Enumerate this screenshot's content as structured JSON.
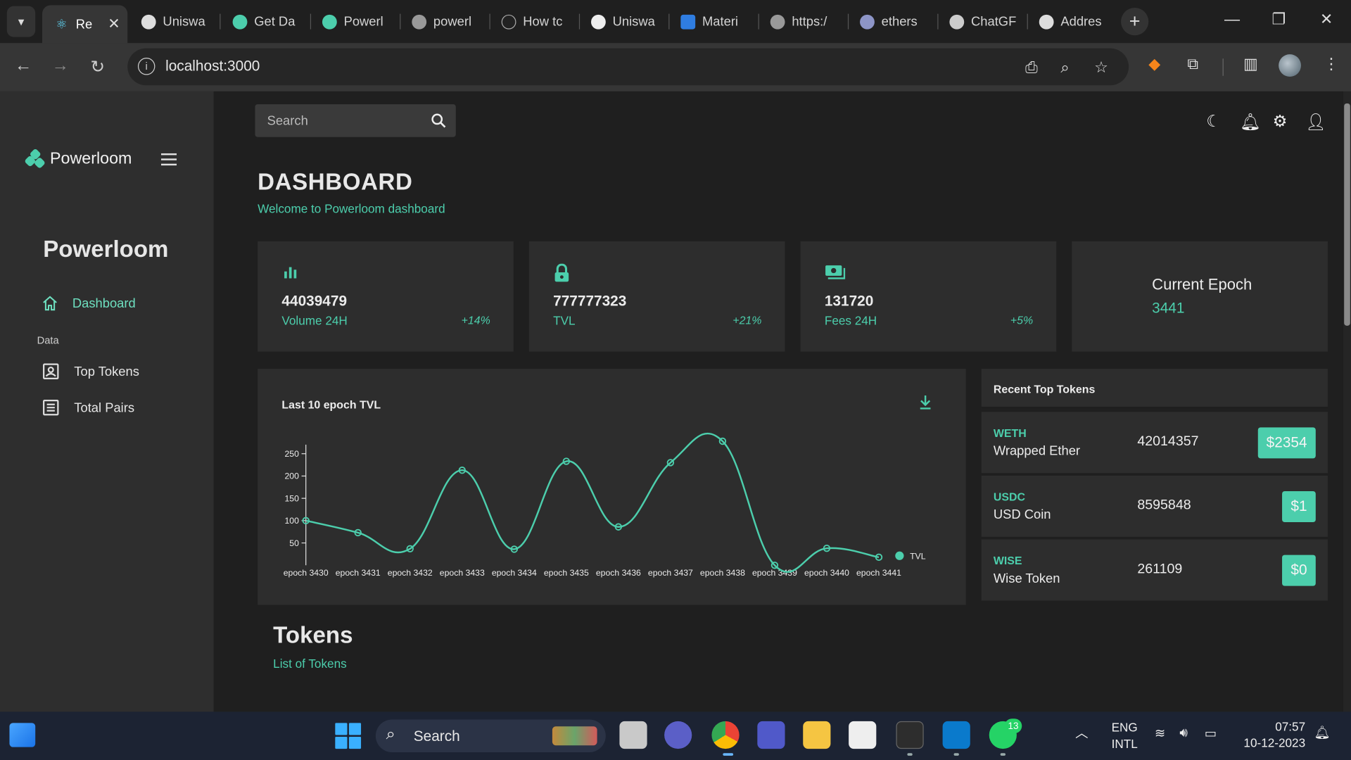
{
  "browser": {
    "tabs": [
      {
        "label": "Re",
        "favicon": "react-icon",
        "active": true
      },
      {
        "label": "Uniswa",
        "favicon": "uniswap-icon"
      },
      {
        "label": "Get Da",
        "favicon": "powerloom-icon"
      },
      {
        "label": "Powerl",
        "favicon": "powerloom-icon"
      },
      {
        "label": "powerl",
        "favicon": "globe-icon"
      },
      {
        "label": "How tc",
        "favicon": "code-icon"
      },
      {
        "label": "Uniswa",
        "favicon": "github-icon"
      },
      {
        "label": "Materi",
        "favicon": "mui-icon"
      },
      {
        "label": "https:/",
        "favicon": "globe-icon"
      },
      {
        "label": "ethers",
        "favicon": "ethers-icon"
      },
      {
        "label": "ChatGF",
        "favicon": "chatgpt-icon"
      },
      {
        "label": "Addres",
        "favicon": "etherscan-icon"
      }
    ],
    "url": "localhost:3000"
  },
  "app": {
    "brand": "Powerloom",
    "sidebar_title": "Powerloom",
    "nav": {
      "dashboard": "Dashboard",
      "section_data": "Data",
      "top_tokens": "Top Tokens",
      "total_pairs": "Total Pairs"
    },
    "search_placeholder": "Search",
    "page_title": "DASHBOARD",
    "page_subtitle": "Welcome to Powerloom dashboard",
    "stats": [
      {
        "value": "44039479",
        "label": "Volume 24H",
        "change": "+14%",
        "icon": "bar-chart-icon"
      },
      {
        "value": "777777323",
        "label": "TVL",
        "change": "+21%",
        "icon": "lock-icon"
      },
      {
        "value": "131720",
        "label": "Fees 24H",
        "change": "+5%",
        "icon": "money-icon"
      }
    ],
    "epoch": {
      "title": "Current Epoch",
      "value": "3441"
    },
    "chart_title": "Last 10 epoch TVL",
    "recent": {
      "title": "Recent Top Tokens",
      "tokens": [
        {
          "symbol": "WETH",
          "name": "Wrapped Ether",
          "amount": "42014357",
          "price": "$2354"
        },
        {
          "symbol": "USDC",
          "name": "USD Coin",
          "amount": "8595848",
          "price": "$1"
        },
        {
          "symbol": "WISE",
          "name": "Wise Token",
          "amount": "261109",
          "price": "$0"
        }
      ]
    },
    "tokens_title": "Tokens",
    "tokens_subtitle": "List of Tokens",
    "accent_color": "#4cceac"
  },
  "chart_data": {
    "type": "line",
    "title": "Last 10 epoch TVL",
    "categories": [
      "epoch 3430",
      "epoch 3431",
      "epoch 3432",
      "epoch 3433",
      "epoch 3434",
      "epoch 3435",
      "epoch 3436",
      "epoch 3437",
      "epoch 3438",
      "epoch 3439",
      "epoch 3440",
      "epoch 3441"
    ],
    "series": [
      {
        "name": "TVL",
        "values": [
          100,
          73,
          37,
          213,
          36,
          233,
          86,
          230,
          278,
          0,
          38,
          18
        ]
      }
    ],
    "y_ticks": [
      50,
      100,
      150,
      200,
      250
    ],
    "ylim": [
      0,
      280
    ],
    "legend": "right",
    "grid": false
  },
  "taskbar": {
    "search_label": "Search",
    "lang_top": "ENG",
    "lang_bottom": "INTL",
    "time": "07:57",
    "date": "10-12-2023",
    "whatsapp_badge": "13"
  }
}
